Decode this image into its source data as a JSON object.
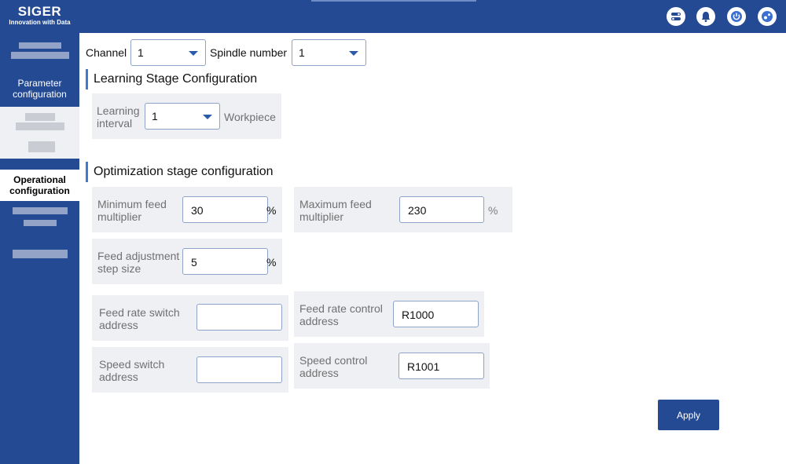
{
  "brand": {
    "name": "SIGER",
    "tagline": "Innovation with Data"
  },
  "header_icons": [
    "toggle-icon",
    "bell-icon",
    "power-icon",
    "settings-icon"
  ],
  "sidebar": {
    "parameter_config": "Parameter configuration",
    "operational_config": "Operational configuration"
  },
  "filters": {
    "channel_label": "Channel",
    "channel_value": "1",
    "spindle_label": "Spindle number",
    "spindle_value": "1"
  },
  "learning": {
    "title": "Learning Stage Configuration",
    "interval_label": "Learning interval",
    "interval_value": "1",
    "interval_unit": "Workpiece"
  },
  "optimization": {
    "title": "Optimization stage configuration",
    "min_feed_label": "Minimum feed multiplier",
    "min_feed_value": "30",
    "max_feed_label": "Maximum feed multiplier",
    "max_feed_value": "230",
    "step_label": "Feed adjustment step size",
    "step_value": "5",
    "percent": "%",
    "feed_switch_label": "Feed rate switch address",
    "feed_switch_value": "",
    "feed_control_label": "Feed rate control address",
    "feed_control_value": "R1000",
    "speed_switch_label": "Speed switch address",
    "speed_switch_value": "",
    "speed_control_label": "Speed control address",
    "speed_control_value": "R1001"
  },
  "apply_label": "Apply",
  "colors": {
    "primary": "#244a93",
    "accent": "#3f7ad6",
    "panel": "#eef0f4"
  }
}
